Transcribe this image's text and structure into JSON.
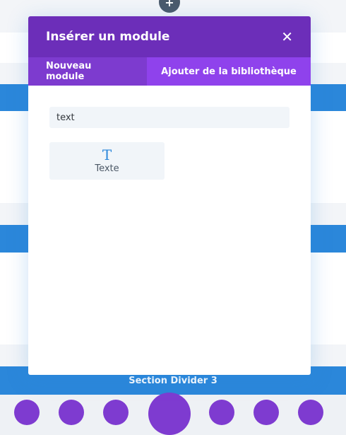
{
  "builder": {
    "top_add_icon": "plus-icon",
    "section_label": "Section Divider 3",
    "colors": {
      "section_blue": "#2b87da",
      "purple": "#7e3bd0",
      "dark_plus": "#4a5a6b"
    }
  },
  "modal": {
    "title": "Insérer un module",
    "close_icon": "close-icon",
    "tabs": [
      {
        "label": "Nouveau module",
        "active": true
      },
      {
        "label": "Ajouter de la bibliothèque",
        "active": false
      }
    ],
    "search": {
      "value": "text",
      "placeholder": ""
    },
    "modules": [
      {
        "icon_glyph": "T",
        "icon": "text-module-icon",
        "label": "Texte"
      }
    ],
    "colors": {
      "header": "#6c2eb9",
      "tabs_bar": "#8f42ec",
      "active_tab": "#7d3bcf",
      "icon_blue": "#2b87da"
    }
  }
}
